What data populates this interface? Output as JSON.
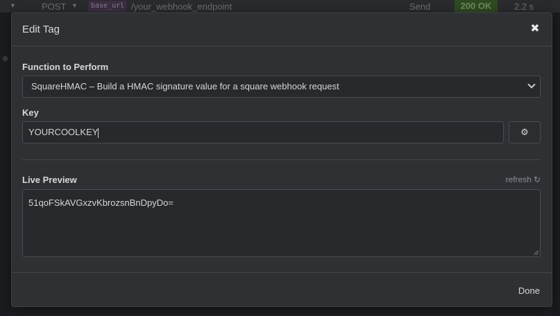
{
  "background": {
    "method": "POST",
    "url_variable": "base_url",
    "url_path": "/your_webhook_endpoint",
    "send_label": "Send",
    "status": "200 OK",
    "time": "2.2 s"
  },
  "modal": {
    "title": "Edit Tag",
    "close_glyph": "✖",
    "function_label": "Function to Perform",
    "function_value": "SquareHMAC – Build a HMAC signature value for a square webhook request",
    "key_label": "Key",
    "key_value": "YOURCOOLKEY",
    "gear_glyph": "⚙",
    "live_preview_label": "Live Preview",
    "refresh_label": "refresh",
    "refresh_glyph": "↻",
    "preview_value": "51qoFSkAVGxzvKbrozsnBnDpyDo=",
    "done_label": "Done"
  },
  "colors": {
    "status_bg": "#2f4a22",
    "modal_bg": "#2e3033",
    "input_bg": "#27292c"
  }
}
